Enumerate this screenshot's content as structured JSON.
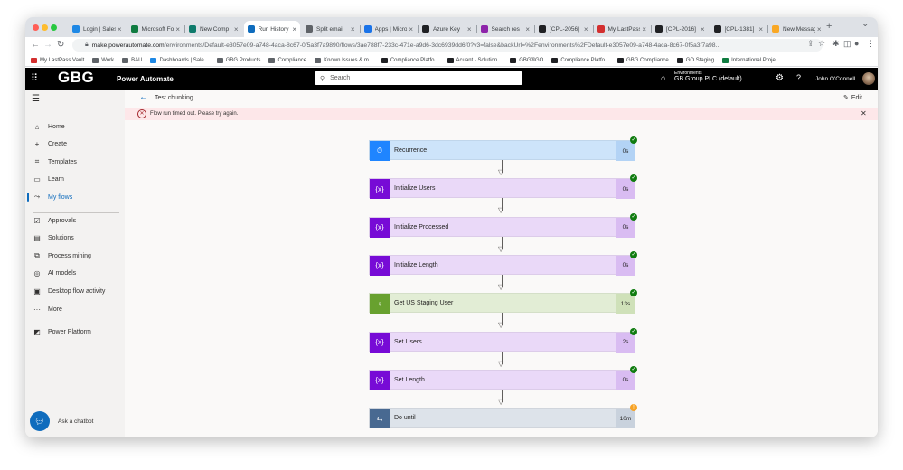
{
  "browser": {
    "tabs": [
      {
        "title": "Login | Sales",
        "favicon_color": "#1e88e5"
      },
      {
        "title": "Microsoft Forms",
        "favicon_color": "#107c41"
      },
      {
        "title": "New Comp",
        "favicon_color": "#0f7b6c"
      },
      {
        "title": "Run History",
        "favicon_color": "#0f6cbd"
      },
      {
        "title": "Split email",
        "favicon_color": "#5f6368"
      },
      {
        "title": "Apps | Microsoft",
        "favicon_color": "#1a73e8"
      },
      {
        "title": "Azure Key",
        "favicon_color": "#202124"
      },
      {
        "title": "Search res",
        "favicon_color": "#8e24aa"
      },
      {
        "title": "[CPL-2056]",
        "favicon_color": "#202124"
      },
      {
        "title": "My LastPass",
        "favicon_color": "#d32f2f"
      },
      {
        "title": "[CPL-2016]",
        "favicon_color": "#202124"
      },
      {
        "title": "[CPL-1381]",
        "favicon_color": "#202124"
      },
      {
        "title": "New Message",
        "favicon_color": "#f9a825"
      }
    ],
    "active_tab_index": 3,
    "new_tab_symbol": "+",
    "dropdown_symbol": "⌄",
    "url_domain": "make.powerautomate.com",
    "url_path": "/environments/Default-e3057e09-a748-4aca-8c67-0f5a3f7a9890/flows/3ae788f7-233c-471e-a9d6-3dc6939dd6f0?v3=false&backUrl=%2Fenvironments%2FDefault-e3057e09-a748-4aca-8c67-0f5a3f7a98...",
    "bookmarks": [
      {
        "label": "My LastPass Vault",
        "icon_color": "#d32f2f"
      },
      {
        "label": "Work",
        "icon_color": "#5f6368"
      },
      {
        "label": "BAU",
        "icon_color": "#5f6368"
      },
      {
        "label": "Dashboards | Sale...",
        "icon_color": "#1e88e5"
      },
      {
        "label": "GBG Products",
        "icon_color": "#5f6368"
      },
      {
        "label": "Compliance",
        "icon_color": "#5f6368"
      },
      {
        "label": "Known Issues & m...",
        "icon_color": "#5f6368"
      },
      {
        "label": "Compliance Platfo...",
        "icon_color": "#202124"
      },
      {
        "label": "Acuant - Solution...",
        "icon_color": "#202124"
      },
      {
        "label": "GBG®GO",
        "icon_color": "#202124"
      },
      {
        "label": "Compliance Platfo...",
        "icon_color": "#202124"
      },
      {
        "label": "GBG Compliance",
        "icon_color": "#202124"
      },
      {
        "label": "GO Staging",
        "icon_color": "#202124"
      },
      {
        "label": "International Proje...",
        "icon_color": "#107c41"
      }
    ]
  },
  "header": {
    "logo": "GBG",
    "app_name": "Power Automate",
    "search_placeholder": "Search",
    "env_label": "Environments",
    "env_value": "GB Group PLC (default) ...",
    "user_name": "John O'Connell"
  },
  "nav": {
    "items": [
      {
        "label": "Home",
        "icon": "home-icon",
        "glyph": "⌂"
      },
      {
        "label": "Create",
        "icon": "plus-icon",
        "glyph": "+"
      },
      {
        "label": "Templates",
        "icon": "templates-icon",
        "glyph": "⌗"
      },
      {
        "label": "Learn",
        "icon": "book-icon",
        "glyph": "▭"
      },
      {
        "label": "My flows",
        "icon": "flows-icon",
        "glyph": "⤳",
        "selected": true
      },
      {
        "label": "Approvals",
        "icon": "approvals-icon",
        "glyph": "☑"
      },
      {
        "label": "Solutions",
        "icon": "solutions-icon",
        "glyph": "▤"
      },
      {
        "label": "Process mining",
        "icon": "process-mining-icon",
        "glyph": "⧉"
      },
      {
        "label": "AI models",
        "icon": "ai-models-icon",
        "glyph": "◎"
      },
      {
        "label": "Desktop flow activity",
        "icon": "desktop-flow-icon",
        "glyph": "▣"
      },
      {
        "label": "More",
        "icon": "more-icon",
        "glyph": "···"
      },
      {
        "label": "Power Platform",
        "icon": "power-platform-icon",
        "glyph": "◩"
      }
    ],
    "chatbot_label": "Ask a chatbot"
  },
  "commandbar": {
    "flow_name": "Test chunking",
    "edit_label": "Edit"
  },
  "error": {
    "message": "Flow run timed out. Please try again."
  },
  "steps": [
    {
      "name": "Recurrence",
      "duration": "0s",
      "status": "success",
      "icon": "clock-icon",
      "glyph": "⏱",
      "icon_color": "#1f85ff",
      "bg_color": "#cde4fa",
      "dur_color": "#b3d3f5"
    },
    {
      "name": "Initialize Users",
      "duration": "0s",
      "status": "success",
      "icon": "variable-icon",
      "glyph": "{x}",
      "icon_color": "#770bd6",
      "bg_color": "#ead9f8",
      "dur_color": "#d9bcf2"
    },
    {
      "name": "Initialize Processed",
      "duration": "0s",
      "status": "success",
      "icon": "variable-icon",
      "glyph": "{x}",
      "icon_color": "#770bd6",
      "bg_color": "#ead9f8",
      "dur_color": "#d9bcf2"
    },
    {
      "name": "Initialize Length",
      "duration": "0s",
      "status": "success",
      "icon": "variable-icon",
      "glyph": "{x}",
      "icon_color": "#770bd6",
      "bg_color": "#ead9f8",
      "dur_color": "#d9bcf2"
    },
    {
      "name": "Get US Staging User",
      "duration": "13s",
      "status": "success",
      "icon": "lightbulb-icon",
      "glyph": "♀",
      "icon_color": "#68a12f",
      "bg_color": "#e2edd5",
      "dur_color": "#cfe1b9"
    },
    {
      "name": "Set Users",
      "duration": "2s",
      "status": "success",
      "icon": "variable-icon",
      "glyph": "{x}",
      "icon_color": "#770bd6",
      "bg_color": "#ead9f8",
      "dur_color": "#d9bcf2"
    },
    {
      "name": "Set Length",
      "duration": "0s",
      "status": "success",
      "icon": "variable-icon",
      "glyph": "{x}",
      "icon_color": "#770bd6",
      "bg_color": "#ead9f8",
      "dur_color": "#d9bcf2"
    },
    {
      "name": "Do until",
      "duration": "10m",
      "status": "timed-out",
      "icon": "loop-icon",
      "glyph": "⇆",
      "icon_color": "#486991",
      "bg_color": "#dde3ea",
      "dur_color": "#c9d2dd"
    }
  ],
  "colors": {
    "accent": "#0f6cbd",
    "success": "#107c10",
    "warning": "#f7a325",
    "error_bg": "#fde7e9",
    "error": "#a4262c"
  }
}
